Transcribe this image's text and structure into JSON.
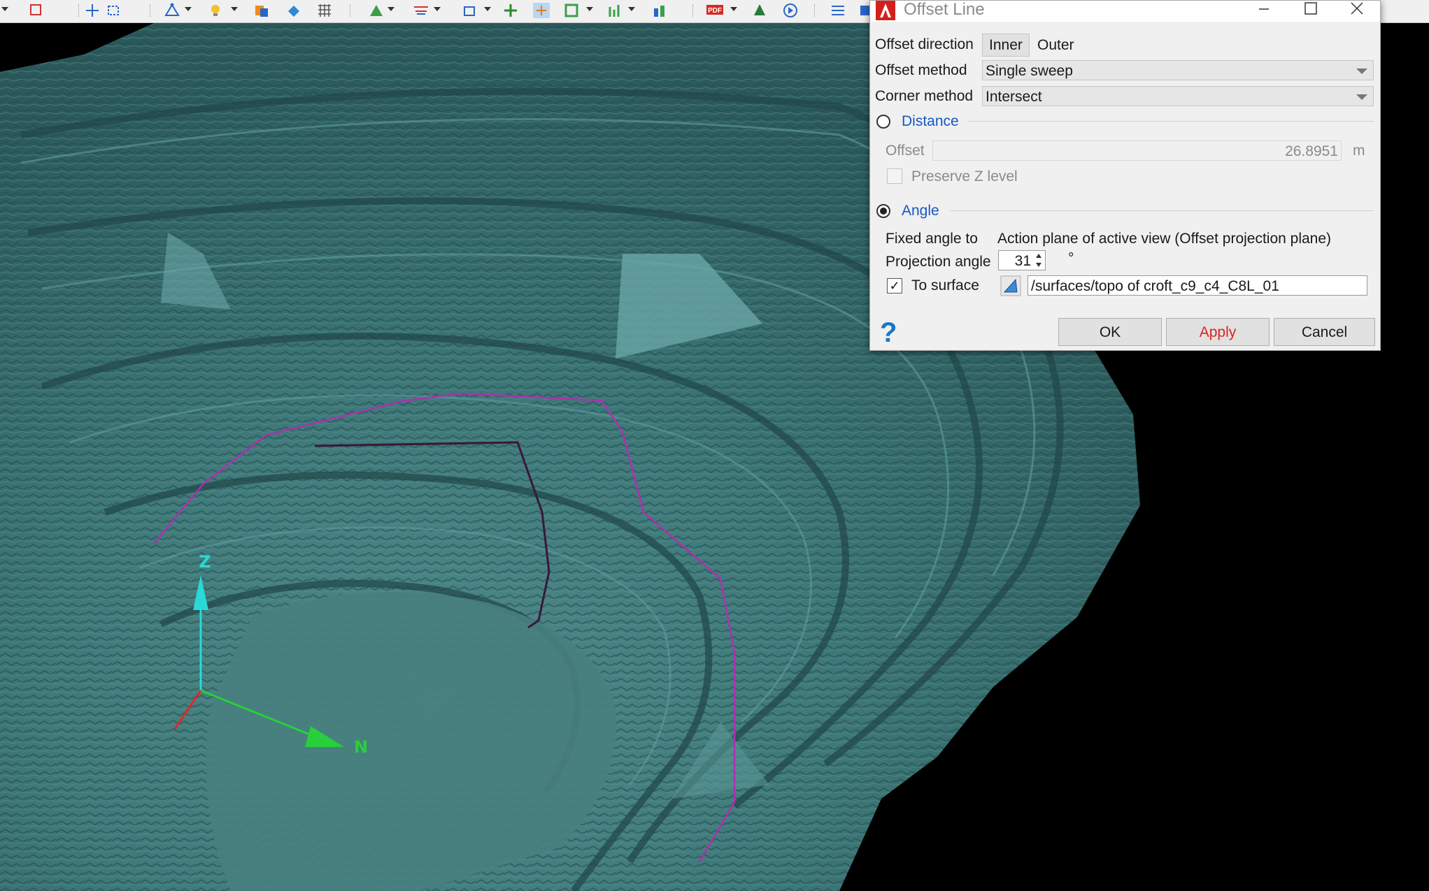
{
  "dialog": {
    "title": "Offset Line",
    "offset_direction": {
      "label": "Offset direction",
      "option_inner": "Inner",
      "option_outer": "Outer",
      "selected": "Inner"
    },
    "offset_method": {
      "label": "Offset method",
      "value": "Single sweep"
    },
    "corner_method": {
      "label": "Corner method",
      "value": "Intersect"
    },
    "distance": {
      "title": "Distance",
      "selected": false,
      "offset_label": "Offset",
      "offset_value": "26.8951",
      "offset_unit": "m",
      "preserve_z_label": "Preserve Z level",
      "preserve_z_checked": false
    },
    "angle": {
      "title": "Angle",
      "selected": true,
      "fixed_angle_label": "Fixed angle to",
      "fixed_angle_value": "Action plane of active view (Offset projection plane)",
      "projection_angle_label": "Projection angle",
      "projection_angle_value": "31",
      "degree_symbol": "°",
      "to_surface_label": "To surface",
      "to_surface_checked": true,
      "check_mark": "✓",
      "surface_path": "/surfaces/topo of croft_c9_c4_C8L_01"
    },
    "buttons": {
      "ok": "OK",
      "apply": "Apply",
      "cancel": "Cancel"
    },
    "help_glyph": "?",
    "colors": {
      "accent_blue": "#1558c4",
      "apply_red": "#e0201c",
      "help_blue": "#1a76c8"
    }
  },
  "viewport": {
    "axis_z_label": "Z",
    "axis_n_label": "N",
    "surface_color": "#3d7374",
    "line_magenta": "#b02fb0",
    "line_dark": "#3a1838"
  },
  "toolbar": {
    "icons": [
      "select-icon",
      "box-select-icon",
      "node-icon",
      "bulb-icon",
      "layers-icon",
      "paint-icon",
      "grid-icon",
      "triangle-icon",
      "plane-icon",
      "window-icon",
      "move-icon",
      "snap-icon",
      "frame-icon",
      "chart-icon",
      "bars-icon",
      "pdf-icon",
      "tree-icon",
      "play-icon",
      "list-icon"
    ]
  }
}
